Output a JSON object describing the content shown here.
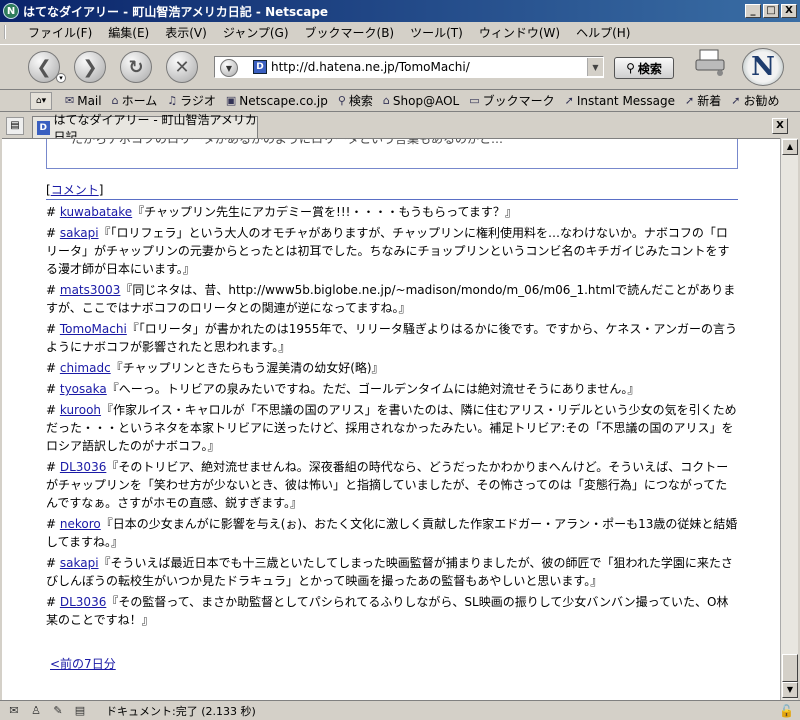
{
  "window": {
    "title": "はてなダイアリー - 町山智浩アメリカ日記 - Netscape",
    "minimize": "_",
    "maximize": "□",
    "close": "X"
  },
  "menu": [
    "ファイル(F)",
    "編集(E)",
    "表示(V)",
    "ジャンプ(G)",
    "ブックマーク(B)",
    "ツール(T)",
    "ウィンドウ(W)",
    "ヘルプ(H)"
  ],
  "nav": {
    "url": "http://d.hatena.ne.jp/TomoMachi/",
    "search_label": "検索"
  },
  "bookmarks": [
    {
      "icon": "mail-icon",
      "glyph": "✉",
      "label": "Mail"
    },
    {
      "icon": "home-icon",
      "glyph": "⌂",
      "label": "ホーム"
    },
    {
      "icon": "radio-icon",
      "glyph": "♫",
      "label": "ラジオ"
    },
    {
      "icon": "my-icon",
      "glyph": "▣",
      "label": "Netscape.co.jp"
    },
    {
      "icon": "search-icon",
      "glyph": "⚲",
      "label": "検索"
    },
    {
      "icon": "shop-icon",
      "glyph": "⌂",
      "label": "Shop@AOL"
    },
    {
      "icon": "folder-icon",
      "glyph": "▭",
      "label": "ブックマーク"
    },
    {
      "icon": "bookmark-icon",
      "glyph": "➚",
      "label": "Instant Message"
    },
    {
      "icon": "bookmark-icon",
      "glyph": "➚",
      "label": "新着"
    },
    {
      "icon": "bookmark-icon",
      "glyph": "➚",
      "label": "お勧め"
    }
  ],
  "tab": {
    "label": "はてなダイアリー - 町山智浩アメリカ日記",
    "close": "X"
  },
  "content": {
    "cut_text": "たからナボコフのロリータがあるかのようにロリータという言葉もあるのかと…",
    "comment_heading": "コメント",
    "comments": [
      {
        "user": "kuwabatake",
        "text": "『チャップリン先生にアカデミー賞を!!!・・・・もうもらってます？』"
      },
      {
        "user": "sakapi",
        "text": "『「ロリフェラ」という大人のオモチャがありますが、チャップリンに権利使用料を…なわけないか。ナボコフの「ロリータ」がチャップリンの元妻からとったとは初耳でした。ちなみにチョップリンというコンビ名のキチガイじみたコントをする漫才師が日本にいます。』"
      },
      {
        "user": "mats3003",
        "text": "『同じネタは、昔、http://www5b.biglobe.ne.jp/~madison/mondo/m_06/m06_1.htmlで読んだことがありますが、ここではナボコフのロリータとの関連が逆になってますね。』"
      },
      {
        "user": "TomoMachi",
        "text": "『「ロリータ」が書かれたのは1955年で、リリータ騒ぎよりはるかに後です。ですから、ケネス・アンガーの言うようにナボコフが影響されたと思われます。』"
      },
      {
        "user": "chimadc",
        "text": "『チャップリンときたらもう渥美清の幼女好(略)』"
      },
      {
        "user": "tyosaka",
        "text": "『へーっ。トリビアの泉みたいですね。ただ、ゴールデンタイムには絶対流せそうにありません。』"
      },
      {
        "user": "kurooh",
        "text": "『作家ルイス・キャロルが「不思議の国のアリス」を書いたのは、隣に住むアリス・リデルという少女の気を引くためだった・・・というネタを本家トリビアに送ったけど、採用されなかったみたい。補足トリビア:その「不思議の国のアリス」をロシア語訳したのがナボコフ。』"
      },
      {
        "user": "DL3036",
        "text": "『そのトリビア、絶対流せませんね。深夜番組の時代なら、どうだったかわかりまへんけど。そういえば、コクトーがチャップリンを「笑わせ方が少ないとき、彼は怖い」と指摘していましたが、その怖さってのは「変態行為」につながってたんですなぁ。さすがホモの直感、鋭すぎます。』"
      },
      {
        "user": "nekoro",
        "text": "『日本の少女まんがに影響を与え(ぉ)、おたく文化に激しく貢献した作家エドガー・アラン・ポーも13歳の従妹と結婚してますね。』"
      },
      {
        "user": "sakapi",
        "text": "『そういえば最近日本でも十三歳といたしてしまった映画監督が捕まりましたが、彼の師匠で「狙われた学園に来たさびしんぼうの転校生がいつか見たドラキュラ」とかって映画を撮ったあの監督もあやしいと思います。』"
      },
      {
        "user": "DL3036",
        "text": "『その監督って、まさか助監督としてパシられてるふりしながら、SL映画の振りして少女バンバン撮っていた、O林某のことですね！』"
      }
    ],
    "prev_link": "<前の7日分"
  },
  "status": {
    "text": "ドキュメント:完了 (2.133 秒)"
  }
}
